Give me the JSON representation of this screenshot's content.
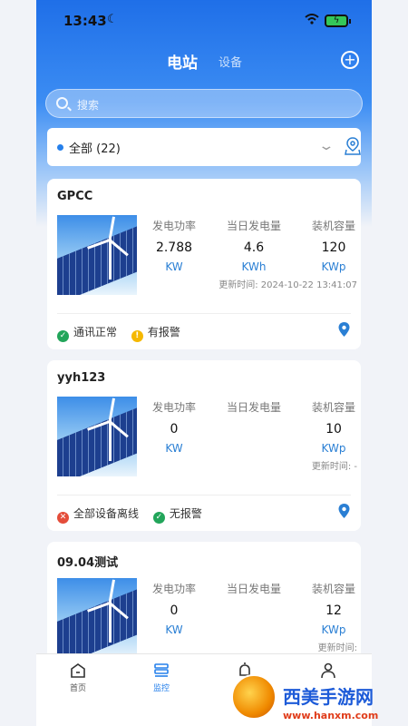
{
  "status_bar": {
    "time": "13:43"
  },
  "header": {
    "tabs": [
      {
        "label": "电站",
        "active": true
      },
      {
        "label": "设备",
        "active": false
      }
    ]
  },
  "search": {
    "placeholder": "搜索"
  },
  "filter": {
    "label": "全部 (22)"
  },
  "stations": [
    {
      "name": "GPCC",
      "metrics": [
        {
          "label": "发电功率",
          "value": "2.788",
          "unit": "KW"
        },
        {
          "label": "当日发电量",
          "value": "4.6",
          "unit": "KWh"
        },
        {
          "label": "装机容量",
          "value": "120",
          "unit": "KWp"
        }
      ],
      "updated": "更新时间: 2024-10-22 13:41:07",
      "statuses": [
        {
          "kind": "ok",
          "text": "通讯正常"
        },
        {
          "kind": "warn",
          "text": "有报警"
        }
      ]
    },
    {
      "name": "yyh123",
      "metrics": [
        {
          "label": "发电功率",
          "value": "0",
          "unit": "KW"
        },
        {
          "label": "当日发电量",
          "value": "",
          "unit": ""
        },
        {
          "label": "装机容量",
          "value": "10",
          "unit": "KWp"
        }
      ],
      "updated": "更新时间: -",
      "statuses": [
        {
          "kind": "bad",
          "text": "全部设备离线"
        },
        {
          "kind": "ok",
          "text": "无报警"
        }
      ]
    },
    {
      "name": "09.04测试",
      "metrics": [
        {
          "label": "发电功率",
          "value": "0",
          "unit": "KW"
        },
        {
          "label": "当日发电量",
          "value": "",
          "unit": ""
        },
        {
          "label": "装机容量",
          "value": "12",
          "unit": "KWp"
        }
      ],
      "updated": "更新时间:",
      "statuses": []
    }
  ],
  "bottom_nav": [
    {
      "label": "首页",
      "active": false
    },
    {
      "label": "监控",
      "active": true
    },
    {
      "label": "",
      "active": false
    },
    {
      "label": "",
      "active": false
    }
  ],
  "watermark": {
    "title": "西美手游网",
    "url": "www.hanxm.com"
  },
  "colors": {
    "accent": "#2680eb",
    "ok": "#22a55a",
    "warn": "#f5b800",
    "bad": "#e44d3a"
  }
}
